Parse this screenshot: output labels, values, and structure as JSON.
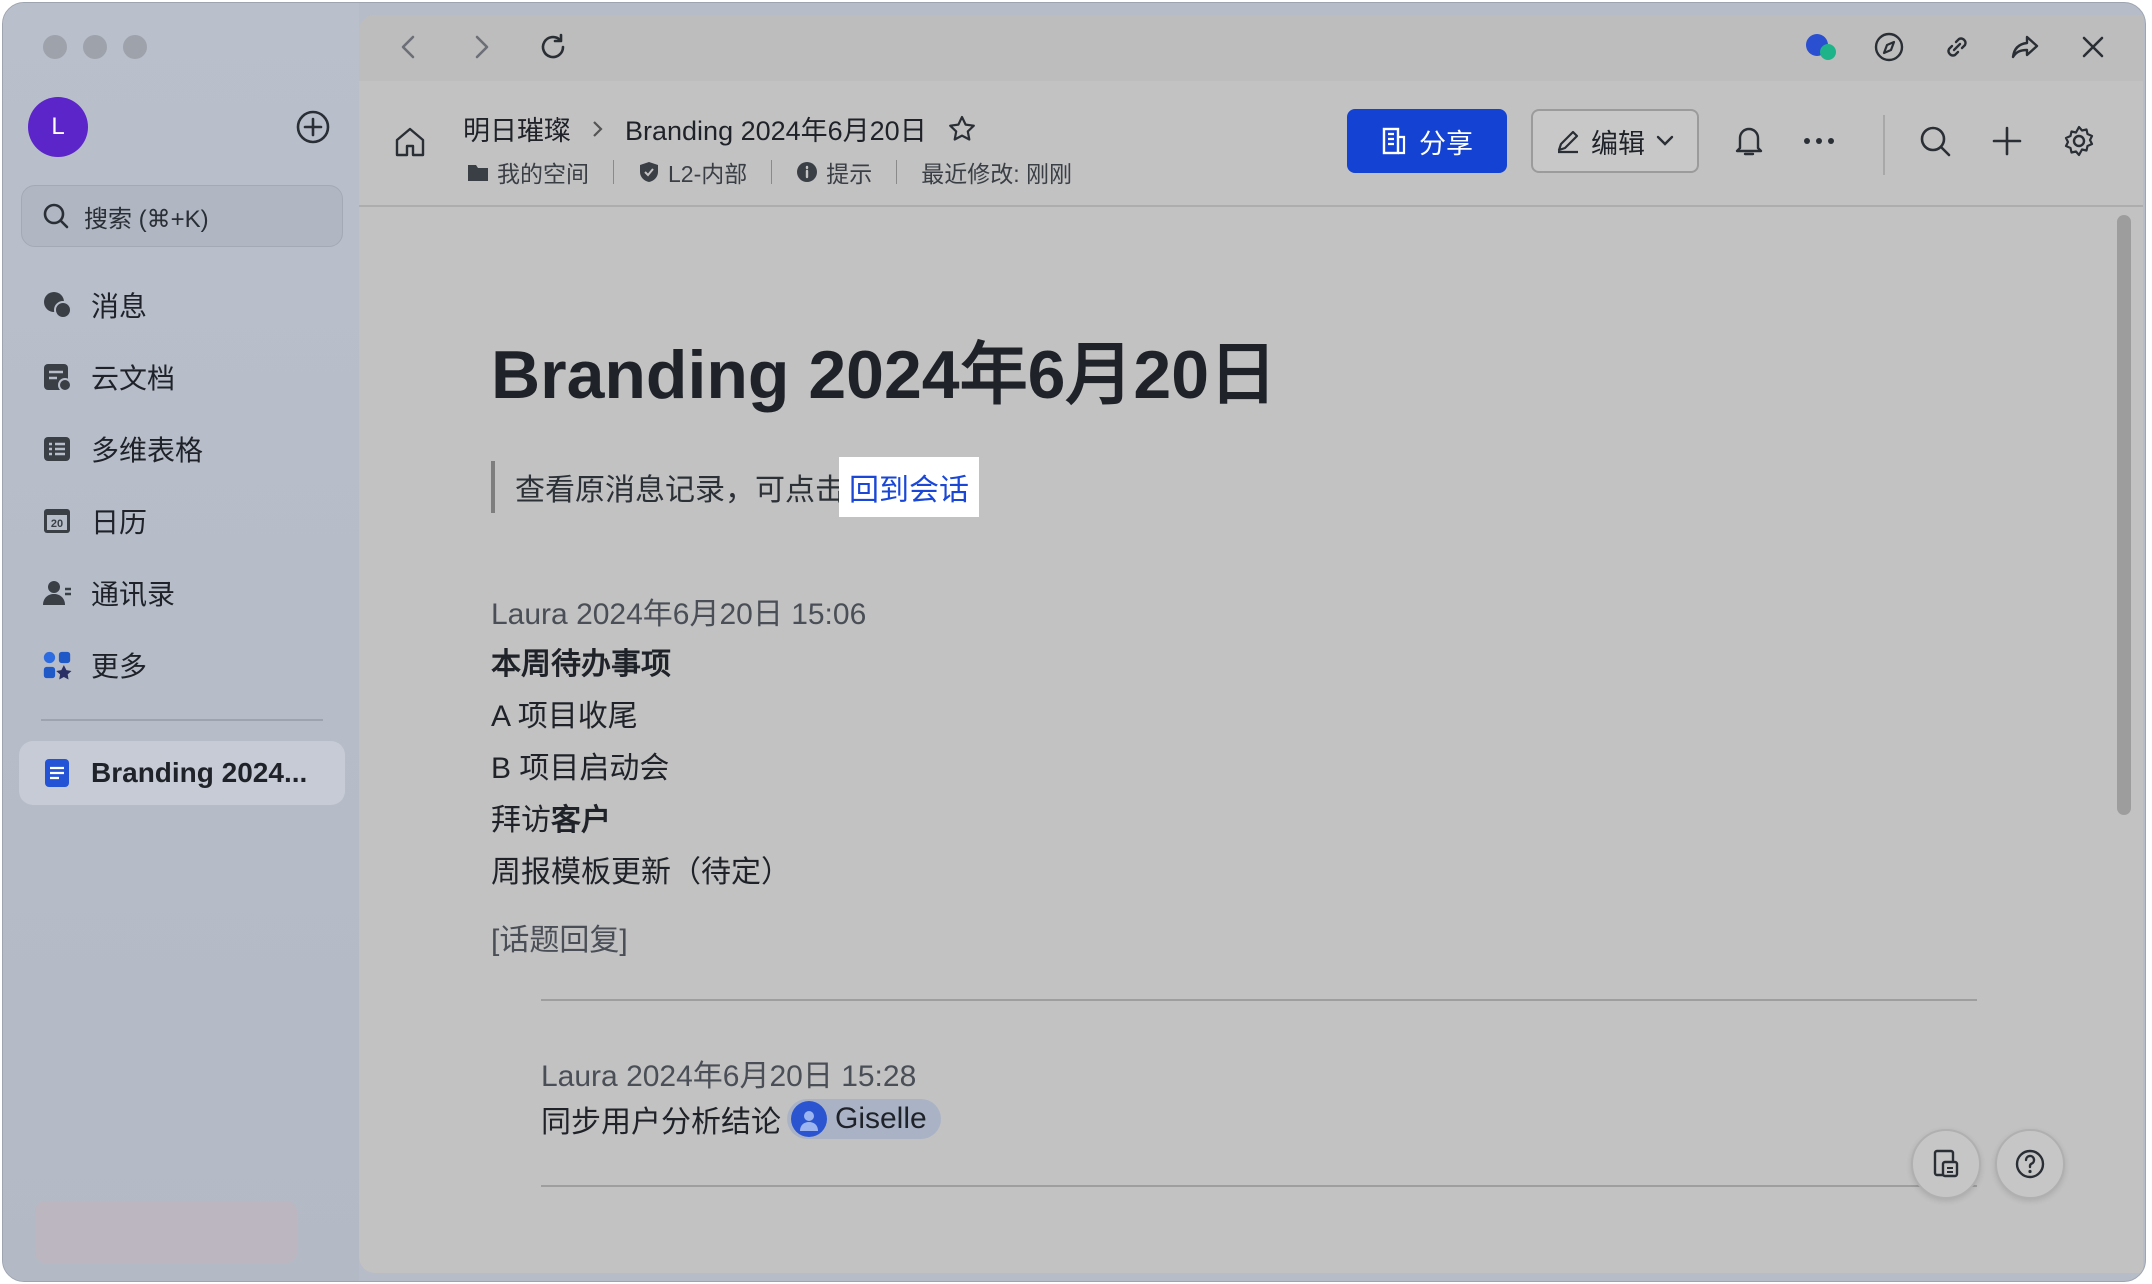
{
  "sidebar": {
    "avatar_letter": "L",
    "search_placeholder": "搜索 (⌘+K)",
    "items": [
      {
        "label": "消息",
        "icon": "chat-bubbles-icon"
      },
      {
        "label": "云文档",
        "icon": "cloud-doc-icon"
      },
      {
        "label": "多维表格",
        "icon": "table-icon"
      },
      {
        "label": "日历",
        "icon": "calendar-icon"
      },
      {
        "label": "通讯录",
        "icon": "contacts-icon"
      },
      {
        "label": "更多",
        "icon": "apps-grid-icon"
      }
    ],
    "calendar_day": "20",
    "recent_doc": "Branding 2024..."
  },
  "header": {
    "workspace": "明日璀璨",
    "doc_name": "Branding 2024年6月20日",
    "meta": {
      "location": "我的空间",
      "security": "L2-内部",
      "hint": "提示",
      "last_modified": "最近修改: 刚刚"
    },
    "share_label": "分享",
    "edit_label": "编辑"
  },
  "document": {
    "title": "Branding 2024年6月20日",
    "quote_text": "查看原消息记录，可点击",
    "quote_link": "回到会话",
    "msg1_header": "Laura 2024年6月20日 15:06",
    "todo_title": "本周待办事项",
    "item_a": "A 项目收尾",
    "item_b": "B 项目启动会",
    "visit_prefix": "拜访",
    "visit_bold": "客户",
    "weekly": "周报模板更新（待定）",
    "topic_reply": "[话题回复]",
    "msg2_header": "Laura 2024年6月20日 15:28",
    "msg2_text": "同步用户分析结论",
    "mention_name": "Giselle"
  },
  "colors": {
    "share_button": "#1443d4",
    "avatar": "#5b25c9",
    "link": "#1a47d6"
  }
}
